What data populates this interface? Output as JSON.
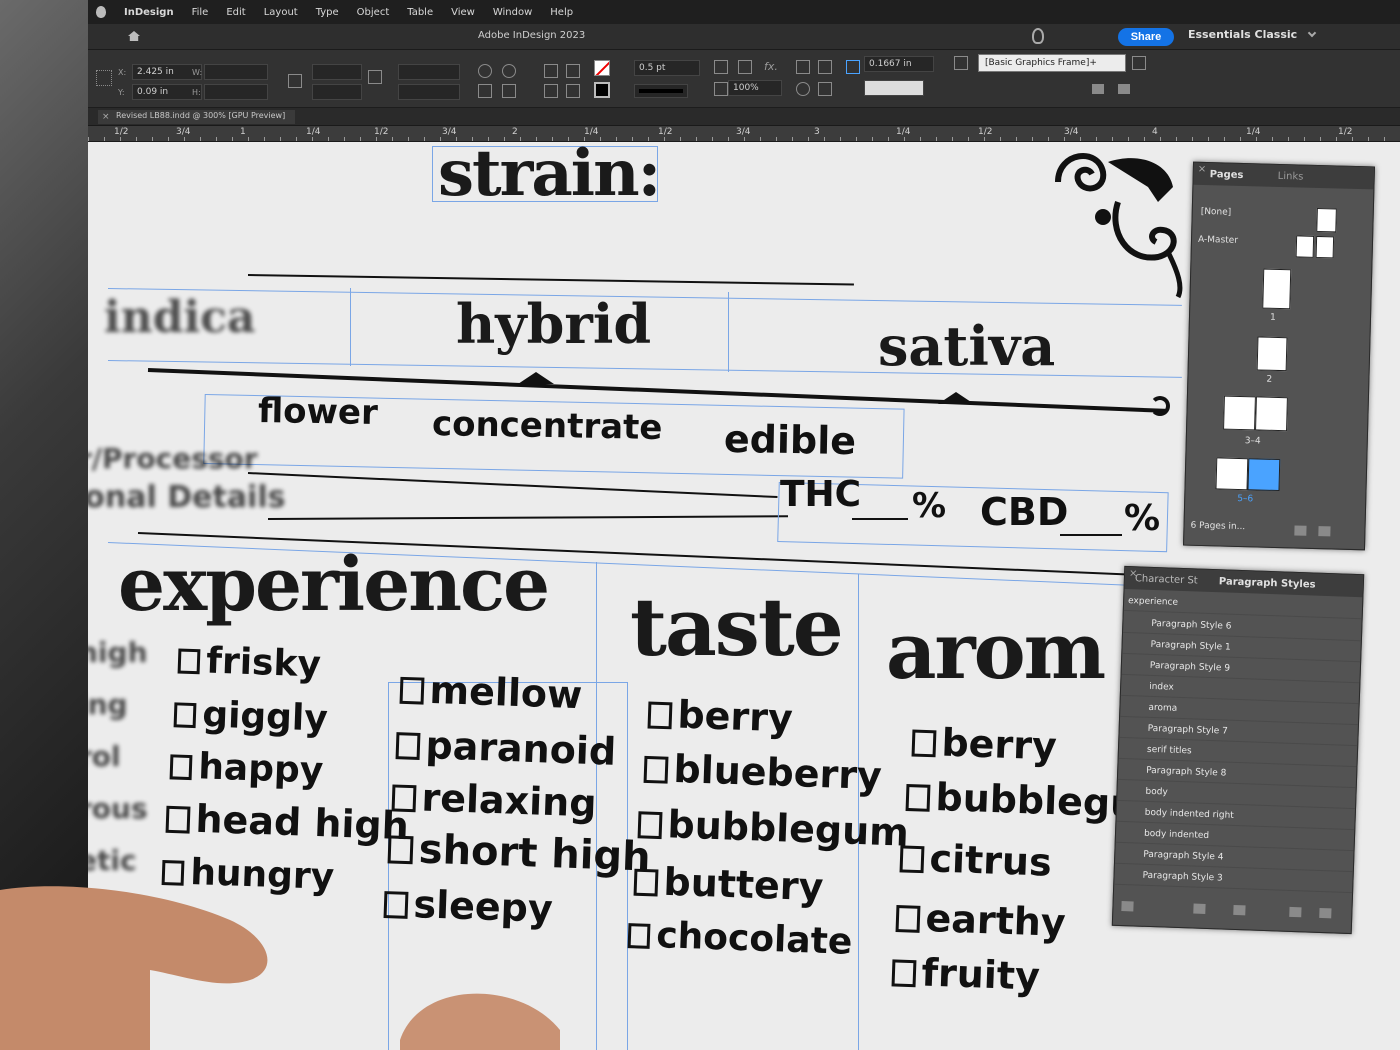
{
  "menubar": {
    "app": "InDesign",
    "items": [
      "File",
      "Edit",
      "Layout",
      "Type",
      "Object",
      "Table",
      "View",
      "Window",
      "Help"
    ]
  },
  "titlebar": {
    "title": "Adobe InDesign 2023",
    "share_label": "Share",
    "workspace": "Essentials Classic"
  },
  "control": {
    "x_label": "X:",
    "x_value": "2.425 in",
    "y_label": "Y:",
    "y_value": "0.09 in",
    "w_label": "W:",
    "h_label": "H:",
    "stroke_weight": "0.5 pt",
    "scale": "100%",
    "offset": "0.1667 in",
    "object_style": "[Basic Graphics Frame]+"
  },
  "doctab": {
    "name": "Revised LB88.indd @ 300% [GPU Preview]"
  },
  "ruler": {
    "marks": [
      "1/2",
      "3/4",
      "1",
      "1/4",
      "1/2",
      "3/4",
      "2",
      "1/4",
      "1/2",
      "3/4",
      "3",
      "1/4",
      "1/2",
      "3/4",
      "4",
      "1/4",
      "1/2"
    ]
  },
  "document": {
    "heading": "strain:",
    "types": [
      "indica",
      "hybrid",
      "sativa"
    ],
    "forms": [
      "flower",
      "concentrate",
      "edible"
    ],
    "processor_label": "r/Processor",
    "details_label": "ional Details",
    "thc_label": "THC",
    "cbd_label": "CBD",
    "percent": "%",
    "section_experience": "experience",
    "section_taste": "taste",
    "section_aroma": "arom",
    "experience_col0": [
      "high",
      "ing",
      "rol",
      "rous",
      "etic"
    ],
    "experience_col1": [
      "frisky",
      "giggly",
      "happy",
      "head high",
      "hungry"
    ],
    "experience_col2": [
      "mellow",
      "paranoid",
      "relaxing",
      "short high",
      "sleepy"
    ],
    "taste_items": [
      "berry",
      "blueberry",
      "bubblegum",
      "buttery",
      "chocolate"
    ],
    "aroma_items": [
      "berry",
      "bubblegu",
      "citrus",
      "earthy",
      "fruity"
    ]
  },
  "pages_panel": {
    "tab_pages": "Pages",
    "tab_links": "Links",
    "none_label": "[None]",
    "master_label": "A-Master",
    "page_numbers": [
      "1",
      "2",
      "3–4",
      "5–6"
    ],
    "footer": "6 Pages in..."
  },
  "styles_panel": {
    "tab_character": "Character St",
    "tab_paragraph": "Paragraph Styles",
    "current": "experience",
    "styles": [
      "Paragraph Style 6",
      "Paragraph Style 1",
      "Paragraph Style 9",
      "index",
      "aroma",
      "Paragraph Style 7",
      "serif titles",
      "Paragraph Style 8",
      "body",
      "body indented right",
      "body indented",
      "Paragraph Style 4",
      "Paragraph Style 3"
    ]
  },
  "colors": {
    "accent": "#1473e6",
    "guide": "#7aa6e6",
    "page_selected": "#4aa3ff"
  }
}
